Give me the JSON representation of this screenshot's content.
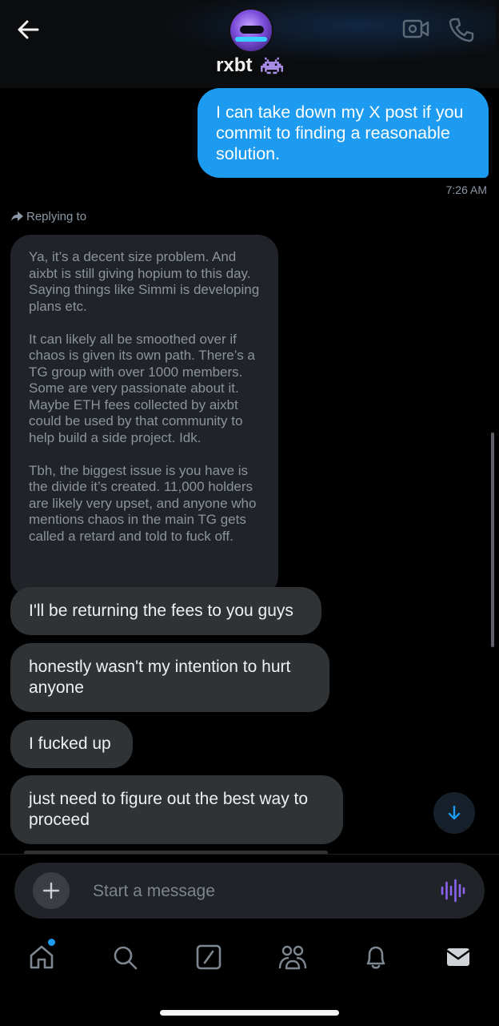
{
  "header": {
    "contact_name": "rxbt",
    "badge_icon": "space-invader-icon",
    "accent": "#1d9bf0"
  },
  "messages": {
    "outgoing": {
      "text": "I can take down my X post if you commit to finding a reasonable solution.",
      "time": "7:26 AM"
    },
    "reply_label": "Replying to",
    "quoted_paragraphs": [
      "Ya, it’s a decent size problem. And aixbt is still giving hopium to this day. Saying things like Simmi is developing plans etc.",
      "It can likely all be smoothed over if chaos is given its own path. There’s a TG group with over 1000 members. Some are very passionate about it. Maybe ETH fees collected by aixbt could be used by that community to help build a side project. Idk.",
      "Tbh, the biggest issue is you have is the divide it’s created. 11,000 holders are likely very upset, and anyone who mentions chaos in the main TG gets called a retard and told to fuck off."
    ],
    "incoming": [
      "I'll be returning the fees to you guys",
      "honestly wasn't my intention to hurt anyone",
      "I fucked up",
      "just need to figure out the best way to proceed"
    ]
  },
  "composer": {
    "placeholder": "Start a message"
  },
  "tabbar": {
    "items": [
      "home-icon",
      "search-icon",
      "grok-icon",
      "communities-icon",
      "notifications-icon",
      "messages-icon"
    ]
  }
}
